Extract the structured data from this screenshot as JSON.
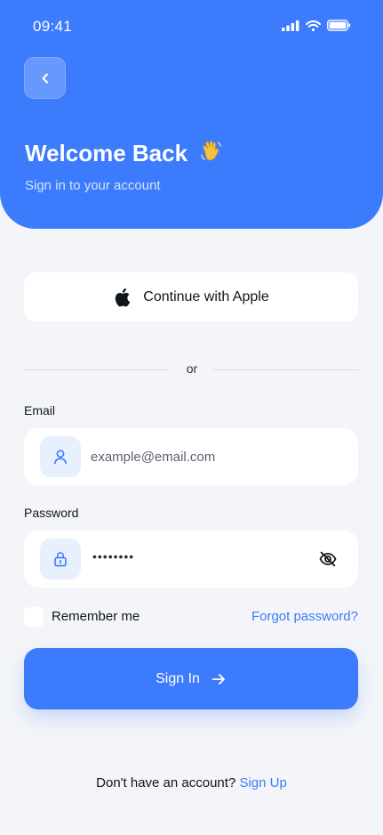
{
  "status_bar": {
    "time": "09:41"
  },
  "header": {
    "title": "Welcome Back",
    "subtitle": "Sign in to your account"
  },
  "social": {
    "apple_label": "Continue with Apple"
  },
  "divider": {
    "text": "or"
  },
  "form": {
    "email_label": "Email",
    "email_placeholder": "example@email.com",
    "email_value": "",
    "password_label": "Password",
    "password_value": "••••••••",
    "remember_label": "Remember me",
    "remember_checked": false,
    "forgot_label": "Forgot password?",
    "submit_label": "Sign In"
  },
  "footer": {
    "prompt": "Don't have an account?",
    "signup_label": "Sign Up"
  },
  "icons": {
    "back": "chevron-left-icon",
    "wave": "waving-hand-icon",
    "apple": "apple-logo-icon",
    "email": "user-icon",
    "password": "lock-icon",
    "toggle_password": "eye-off-icon",
    "submit": "arrow-right-icon"
  },
  "colors": {
    "primary": "#3d7bfd",
    "background": "#f3f5f9",
    "surface": "#ffffff",
    "icon_tint": "#e8f0fe",
    "text": "#11151c"
  }
}
